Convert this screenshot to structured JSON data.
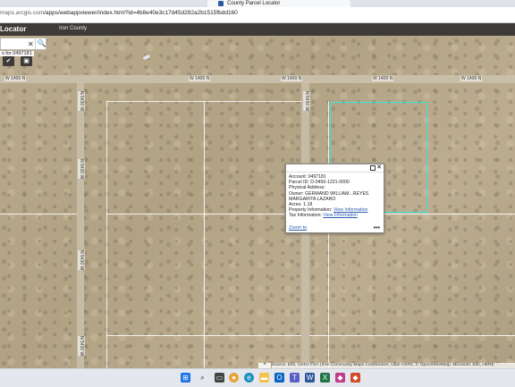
{
  "browser": {
    "tab_title": "County Parcel Locator",
    "url_host": "maps.arcgis.com",
    "url_path": "/apps/webappviewer/index.html?id=4b8e40e3c17d45d282a2b1515fbdd160"
  },
  "app": {
    "title": "Locator",
    "county": "Iron County"
  },
  "search": {
    "value": "",
    "clear_glyph": "✕",
    "button_glyph": "🔍",
    "hint": "s for 0497181"
  },
  "roads": {
    "h_labels": [
      "W 1400 N",
      "W 1400 N",
      "W 1400 N",
      "W 1400 N",
      "W 1400 N"
    ],
    "v_labels": [
      "N 5430 W",
      "N 5430 W",
      "N 5430 W",
      "N 5430 W",
      "N 5430 W"
    ]
  },
  "popup": {
    "account": "Account: 0497181",
    "parcel_id": "Parcel ID: D-0456-1221-0000",
    "physical_address": "Physical Address:",
    "owner": "Owner: GERMAND WILLIAM...REYES",
    "owner2": "MARGARITA LAZARO",
    "acres": "Acres: 1.18",
    "property_info_label": "Property Information:",
    "property_info_link": "View Information",
    "tax_info_label": "Tax Information:",
    "tax_info_link": "View Information",
    "zoom_to": "Zoom to",
    "more": "•••"
  },
  "attribution": "Source: Esri, USDA FSA | Esri Community Maps Contributors, Utah AGRC, © OpenStreetMap, Microsoft, Esri, HERE",
  "colors": {
    "parcel_outline": "#38e6d8",
    "app_header": "#3e3a37",
    "link": "#2a5db0"
  },
  "taskbar": {
    "icons": [
      "windows-icon",
      "search-icon",
      "task-view-icon",
      "chrome-icon",
      "edge-icon",
      "file-explorer-icon",
      "outlook-icon",
      "teams-icon",
      "word-icon",
      "excel-icon",
      "app-icon",
      "app-icon-2"
    ]
  }
}
